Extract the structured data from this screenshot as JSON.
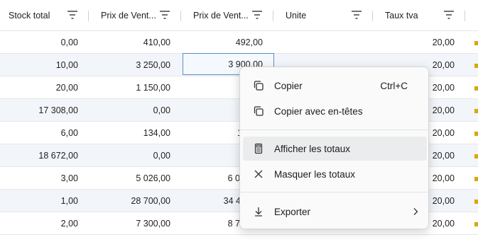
{
  "columns": [
    {
      "label": "Stock total"
    },
    {
      "label": "Prix de Vent..."
    },
    {
      "label": "Prix de Vent..."
    },
    {
      "label": "Unite"
    },
    {
      "label": "Taux tva"
    }
  ],
  "rows": [
    {
      "stock": "0,00",
      "prix1": "410,00",
      "prix2": "492,00",
      "tva": "20,00"
    },
    {
      "stock": "10,00",
      "prix1": "3 250,00",
      "prix2": "3 900,00",
      "tva": "20,00"
    },
    {
      "stock": "20,00",
      "prix1": "1 150,00",
      "prix2": "1 3",
      "tva": "20,00"
    },
    {
      "stock": "17 308,00",
      "prix1": "0,00",
      "prix2": "",
      "tva": "20,00"
    },
    {
      "stock": "6,00",
      "prix1": "134,00",
      "prix2": "1",
      "tva": "20,00"
    },
    {
      "stock": "18 672,00",
      "prix1": "0,00",
      "prix2": "",
      "tva": "20,00"
    },
    {
      "stock": "3,00",
      "prix1": "5 026,00",
      "prix2": "6 0",
      "tva": "20,00"
    },
    {
      "stock": "1,00",
      "prix1": "28 700,00",
      "prix2": "34 4",
      "tva": "20,00"
    },
    {
      "stock": "2,00",
      "prix1": "7 300,00",
      "prix2": "8 7",
      "tva": "20,00"
    }
  ],
  "context_menu": {
    "copy": {
      "label": "Copier",
      "shortcut": "Ctrl+C",
      "icon": "copy-icon"
    },
    "copy_headers": {
      "label": "Copier avec en-têtes",
      "icon": "copy-icon"
    },
    "show_totals": {
      "label": "Afficher les totaux",
      "icon": "calculator-icon"
    },
    "hide_totals": {
      "label": "Masquer les totaux",
      "icon": "close-icon"
    },
    "export": {
      "label": "Exporter",
      "icon": "download-icon"
    }
  },
  "colors": {
    "alt_row": "#f2f5fa",
    "focus_border": "#5a8fc6",
    "menu_hover": "#eaeced"
  }
}
